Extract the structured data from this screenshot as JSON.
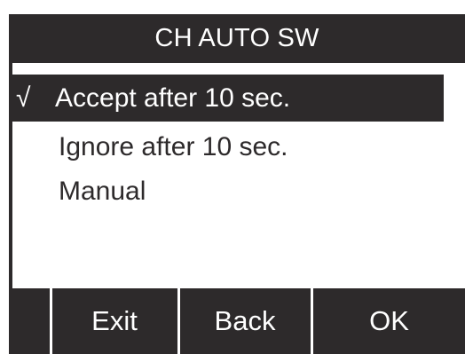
{
  "title": "CH AUTO SW",
  "menu": {
    "items": [
      {
        "check": "√",
        "label": "Accept after 10 sec.",
        "selected": true
      },
      {
        "label": "Ignore after 10 sec.",
        "selected": false
      },
      {
        "label": "Manual",
        "selected": false
      }
    ]
  },
  "softkeys": {
    "exit_label": "Exit",
    "back_label": "Back",
    "ok_label": "OK"
  },
  "colors": {
    "foreground": "#2d2a2b",
    "background": "#ffffff"
  },
  "icons": {
    "check": "checkmark-icon"
  }
}
